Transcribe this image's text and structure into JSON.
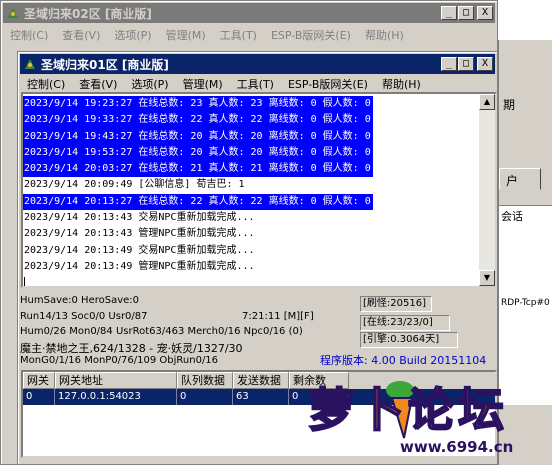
{
  "back_window": {
    "title": "圣域归来02区 [商业版]",
    "menu": [
      "控制(C)",
      "查看(V)",
      "选项(P)",
      "管理(M)",
      "工具(T)",
      "ESP-B版网关(E)",
      "帮助(H)"
    ],
    "right_fragments": {
      "period": "期",
      "account": "户",
      "chat": "会话",
      "tcp": "RDP-Tcp#0"
    }
  },
  "front_window": {
    "title": "圣域归来01区 [商业版]",
    "menu": [
      "控制(C)",
      "查看(V)",
      "选项(P)",
      "管理(M)",
      "工具(T)",
      "ESP-B版网关(E)",
      "帮助(H)"
    ],
    "caption_buttons": [
      "_",
      "□",
      "X"
    ]
  },
  "log": [
    {
      "text": "2023/9/14 19:23:27 在线总数: 23 真人数: 23 离线数: 0 假人数: 0",
      "selected": true
    },
    {
      "text": "2023/9/14 19:33:27 在线总数: 22 真人数: 22 离线数: 0 假人数: 0",
      "selected": true
    },
    {
      "text": "2023/9/14 19:43:27 在线总数: 20 真人数: 20 离线数: 0 假人数: 0",
      "selected": true
    },
    {
      "text": "2023/9/14 19:53:27 在线总数: 20 真人数: 20 离线数: 0 假人数: 0",
      "selected": true
    },
    {
      "text": "2023/9/14 20:03:27 在线总数: 21 真人数: 21 离线数: 0 假人数: 0",
      "selected": true
    },
    {
      "text": "2023/9/14 20:09:49 [公聊信息] 荀吉巴: 1",
      "selected": false
    },
    {
      "text": "2023/9/14 20:13:27 在线总数: 22 真人数: 22 离线数: 0 假人数: 0",
      "selected": true
    },
    {
      "text": "2023/9/14 20:13:43 交易NPC重新加载完成...",
      "selected": false
    },
    {
      "text": "2023/9/14 20:13:43 管理NPC重新加载完成...",
      "selected": false
    },
    {
      "text": "2023/9/14 20:13:49 交易NPC重新加载完成...",
      "selected": false
    },
    {
      "text": "2023/9/14 20:13:49 管理NPC重新加载完成...",
      "selected": false
    }
  ],
  "status": {
    "save_line": "HumSave:0 HeroSave:0",
    "run_line": "Run14/13 Soc0/0 Usr0/87",
    "time": "7:21:11 [M][F]",
    "hum_line": "Hum0/26 Mon0/84 UsrRot63/463 Merch0/16 Npc0/16 (0)",
    "boss_line": "魔主·禁地之王,624/1328 - 宠·妖灵/1327/30",
    "mon_line": "MonG0/1/16 MonP0/76/109 ObjRun0/16",
    "refresh": "[刷怪:20516]",
    "online": "[在线:23/23/0]",
    "engine": "[引擎:0.3064天]",
    "version": "程序版本: 4.00 Build 20151104"
  },
  "grid": {
    "headers": [
      "网关",
      "网关地址",
      "队列数据",
      "发送数据",
      "剩余数"
    ],
    "rows": [
      [
        "0",
        "127.0.0.1:54023",
        "0",
        "63",
        "0"
      ]
    ]
  },
  "watermark": {
    "text": "萝卜论坛",
    "url": "www.6994.cn"
  },
  "colors": {
    "title_active": "#0a246a",
    "selection": "#0000ff",
    "version_text": "#0000cc",
    "watermark_orange": "#f08a1c",
    "watermark_purple": "#2a1260"
  }
}
